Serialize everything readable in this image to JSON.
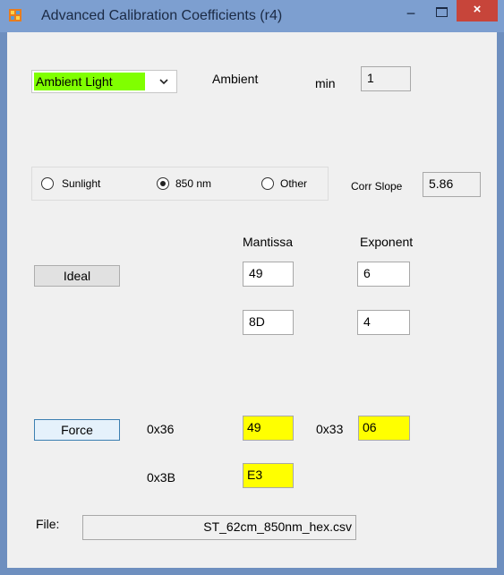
{
  "window": {
    "title": "Advanced Calibration Coefficients (r4)",
    "minimize_glyph": "−",
    "close_glyph": "×"
  },
  "source": {
    "selected": "Ambient Light",
    "label": "Ambient",
    "min_label": "min",
    "min_value": "1"
  },
  "light_type": {
    "options": [
      "Sunlight",
      "850 nm",
      "Other"
    ],
    "selected": "850 nm",
    "corr_slope_label": "Corr Slope",
    "corr_slope_value": "5.86"
  },
  "coefficients": {
    "mantissa_header": "Mantissa",
    "exponent_header": "Exponent",
    "ideal_button": "Ideal",
    "row1": {
      "mantissa": "49",
      "exponent": "6"
    },
    "row2": {
      "mantissa": "8D",
      "exponent": "4"
    }
  },
  "registers": {
    "force_button": "Force",
    "reg1_label": "0x36",
    "reg1_value": "49",
    "reg2_label": "0x33",
    "reg2_value": "06",
    "reg3_label": "0x3B",
    "reg3_value": "E3",
    "highlight_color": "#ffff00"
  },
  "file": {
    "label": "File:",
    "name": "ST_62cm_850nm_hex.csv"
  },
  "colors": {
    "titlebar": "#7d9fd0",
    "close_button": "#c7453a",
    "combo_highlight": "#80ff00"
  }
}
